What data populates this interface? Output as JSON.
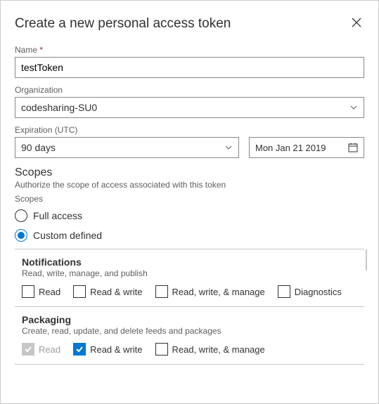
{
  "title": "Create a new personal access token",
  "fields": {
    "name": {
      "label": "Name",
      "required": "*",
      "value": "testToken"
    },
    "organization": {
      "label": "Organization",
      "value": "codesharing-SU0"
    },
    "expiration": {
      "label": "Expiration (UTC)",
      "duration": "90 days",
      "date": "Mon Jan 21 2019"
    }
  },
  "scopes": {
    "title": "Scopes",
    "desc": "Authorize the scope of access associated with this token",
    "sub": "Scopes",
    "radios": {
      "full": "Full access",
      "custom": "Custom defined"
    },
    "groups": [
      {
        "name": "Notifications",
        "desc": "Read, write, manage, and publish",
        "checks": [
          {
            "label": "Read",
            "checked": false,
            "disabled": false
          },
          {
            "label": "Read & write",
            "checked": false,
            "disabled": false
          },
          {
            "label": "Read, write, & manage",
            "checked": false,
            "disabled": false
          },
          {
            "label": "Diagnostics",
            "checked": false,
            "disabled": false
          }
        ]
      },
      {
        "name": "Packaging",
        "desc": "Create, read, update, and delete feeds and packages",
        "checks": [
          {
            "label": "Read",
            "checked": true,
            "disabled": true
          },
          {
            "label": "Read & write",
            "checked": true,
            "disabled": false
          },
          {
            "label": "Read, write, & manage",
            "checked": false,
            "disabled": false
          }
        ]
      }
    ]
  }
}
